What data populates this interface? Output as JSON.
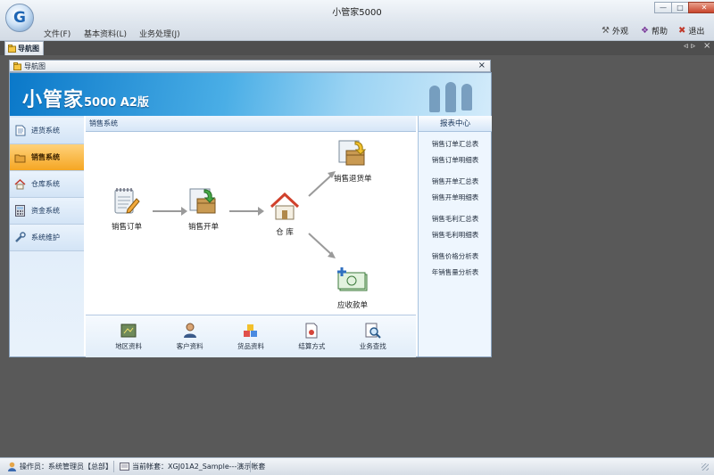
{
  "app": {
    "title": "小管家5000",
    "logo_letter": "G"
  },
  "menu": [
    "文件(F)",
    "基本资料(L)",
    "业务处理(J)"
  ],
  "window_buttons": {
    "minimize": "—",
    "maximize": "□",
    "close": "✕"
  },
  "toolbar": [
    {
      "label": "外观",
      "icon": "wrench-icon",
      "glyph": "⚒"
    },
    {
      "label": "帮助",
      "icon": "help-icon",
      "glyph": "❖"
    },
    {
      "label": "退出",
      "icon": "exit-icon",
      "glyph": "✖"
    }
  ],
  "doc_tab": {
    "label": "导航图",
    "pin": "ᐊ ᐅ",
    "close": "×"
  },
  "panel": {
    "title": "导航图",
    "close": "×"
  },
  "banner": {
    "title": "小管家",
    "subtitle": "5000 A2版"
  },
  "nav": [
    {
      "label": "进货系统",
      "icon": "document-icon",
      "glyph": "📄",
      "active": false
    },
    {
      "label": "销售系统",
      "icon": "folder-icon",
      "glyph": "📁",
      "active": true
    },
    {
      "label": "仓库系统",
      "icon": "home-icon",
      "glyph": "⌂",
      "active": false
    },
    {
      "label": "资金系统",
      "icon": "calculator-icon",
      "glyph": "▦",
      "active": false
    },
    {
      "label": "系统维护",
      "icon": "wrench-icon",
      "glyph": "🔧",
      "active": false
    }
  ],
  "section": {
    "title": "销售系统"
  },
  "flow": {
    "sales_order": "销售订单",
    "sales_invoice": "销售开单",
    "warehouse": "仓  库",
    "sales_return": "销售退货单",
    "receivable": "应收款单"
  },
  "shortcuts": [
    {
      "label": "地区资料",
      "icon": "map-icon"
    },
    {
      "label": "客户资料",
      "icon": "customer-icon"
    },
    {
      "label": "货品资料",
      "icon": "goods-icon"
    },
    {
      "label": "结算方式",
      "icon": "settlement-icon"
    },
    {
      "label": "业务查找",
      "icon": "search-icon"
    }
  ],
  "report": {
    "title": "报表中心",
    "links": [
      "销售订单汇总表",
      "销售订单明细表",
      "销售开单汇总表",
      "销售开单明细表",
      "销售毛利汇总表",
      "销售毛利明细表",
      "销售价格分析表",
      "年销售量分析表"
    ]
  },
  "status": {
    "operator": "操作员：系统管理员【总部】",
    "account": "当前帐套：XGJ01A2_Sample---演示帐套"
  },
  "colors": {
    "accent": "#f5a623",
    "banner": "#0a78c9",
    "frame": "#595959"
  }
}
